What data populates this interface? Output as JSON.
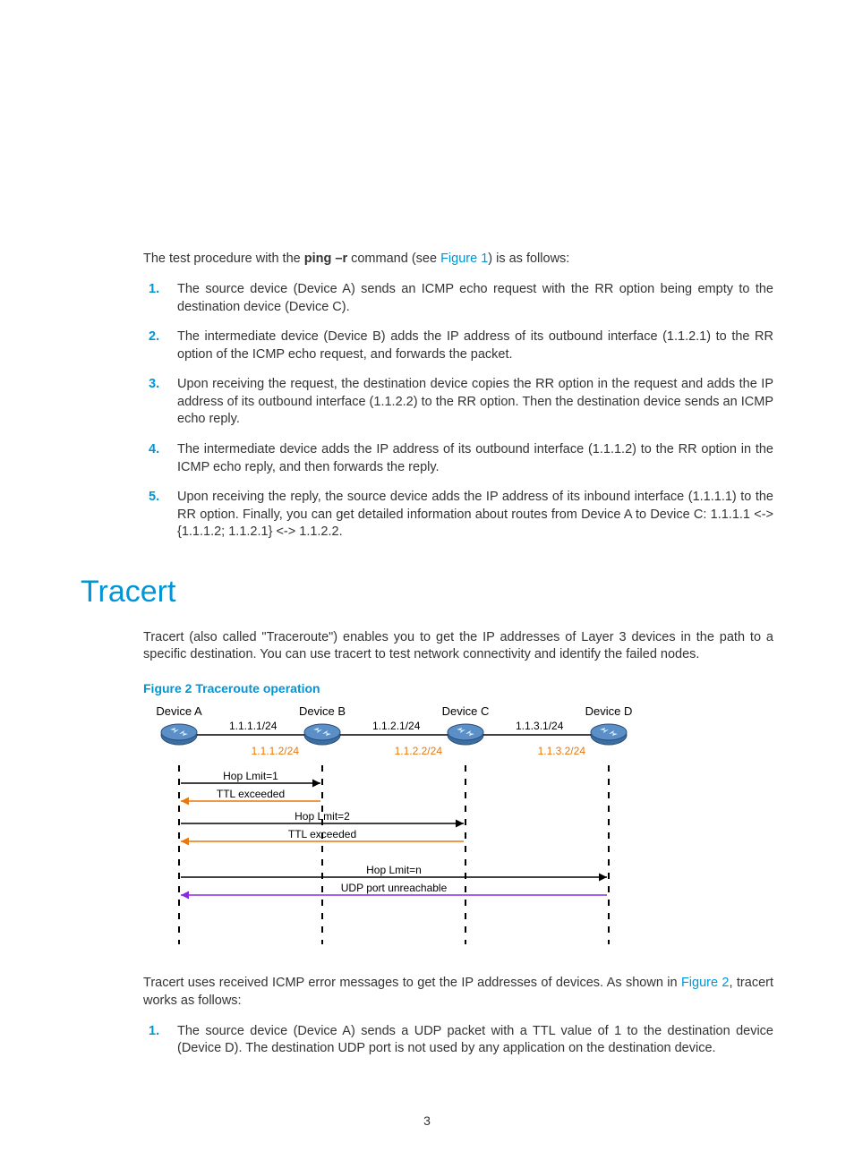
{
  "intro": {
    "pre": "The test procedure with the ",
    "cmd": "ping –r",
    "mid": " command (see ",
    "figref": "Figure 1",
    "post": ") is as follows:"
  },
  "steps1": [
    "The source device (Device A) sends an ICMP echo request with the RR option being empty to the destination device (Device C).",
    "The intermediate device (Device B) adds the IP address of its outbound interface (1.1.2.1) to the RR option of the ICMP echo request, and forwards the packet.",
    "Upon receiving the request, the destination device copies the RR option in the request and adds the IP address of its outbound interface (1.1.2.2) to the RR option. Then the destination device sends an ICMP echo reply.",
    "The intermediate device adds the IP address of its outbound interface (1.1.1.2) to the RR option in the ICMP echo reply, and then forwards the reply.",
    "Upon receiving the reply, the source device adds the IP address of its inbound interface (1.1.1.1) to the RR option. Finally, you can get detailed information about routes from Device A to Device C: 1.1.1.1 <-> {1.1.1.2; 1.1.2.1} <-> 1.1.2.2."
  ],
  "section_title": "Tracert",
  "tracert_para": "Tracert (also called \"Traceroute\") enables you to get the IP addresses of Layer 3 devices in the path to a specific destination. You can use tracert to test network connectivity and identify the failed nodes.",
  "fig2_caption": "Figure 2 Traceroute operation",
  "diag": {
    "devices": [
      "Device A",
      "Device B",
      "Device C",
      "Device D"
    ],
    "ips_top": [
      "1.1.1.1/24",
      "1.1.2.1/24",
      "1.1.3.1/24"
    ],
    "ips_bottom": [
      "1.1.1.2/24",
      "1.1.2.2/24",
      "1.1.3.2/24"
    ],
    "rows": [
      {
        "label": "Hop Lmit=1",
        "from": 0,
        "to": 1,
        "color": "#000"
      },
      {
        "label": "TTL exceeded",
        "from": 1,
        "to": 0,
        "color": "#e8770d"
      },
      {
        "label": "Hop Lmit=2",
        "from": 0,
        "to": 2,
        "color": "#000"
      },
      {
        "label": "TTL exceeded",
        "from": 2,
        "to": 0,
        "color": "#e8770d"
      },
      {
        "label": "Hop Lmit=n",
        "from": 0,
        "to": 3,
        "color": "#000"
      },
      {
        "label": "UDP port unreachable",
        "from": 3,
        "to": 0,
        "color": "#8a2be2"
      }
    ]
  },
  "tracert_after": {
    "pre": "Tracert uses received ICMP error messages to get the IP addresses of devices. As shown in ",
    "figref": "Figure 2",
    "post": ", tracert works as follows:"
  },
  "steps2": [
    "The source device (Device A) sends a UDP packet with a TTL value of 1 to the destination device (Device D). The destination UDP port is not used by any application on the destination device."
  ],
  "pagenum": "3"
}
